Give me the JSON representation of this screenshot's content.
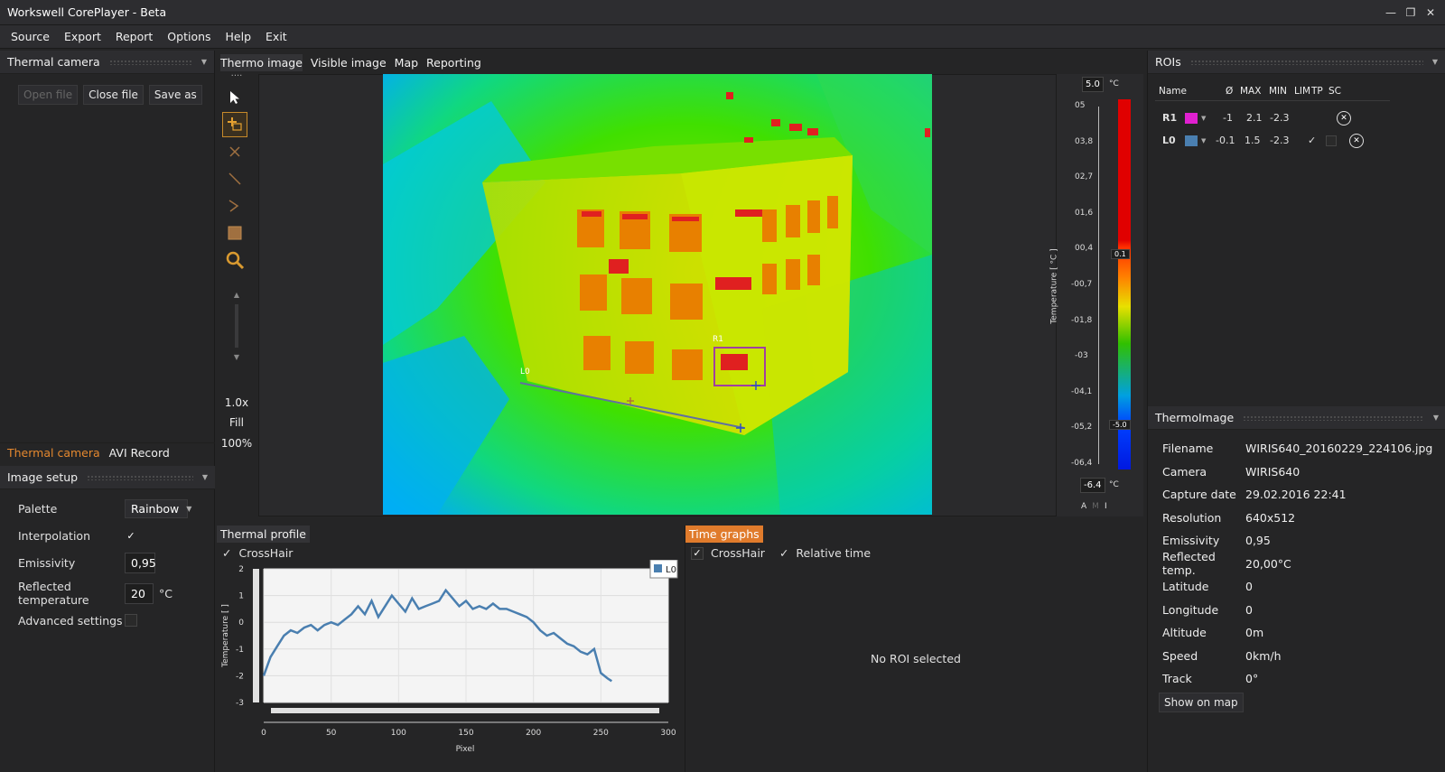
{
  "window": {
    "title": "Workswell CorePlayer - Beta"
  },
  "menu": [
    "Source",
    "Export",
    "Report",
    "Options",
    "Help",
    "Exit"
  ],
  "left": {
    "panel_title": "Thermal camera",
    "buttons": {
      "open": "Open file",
      "close": "Close file",
      "save": "Save as"
    },
    "tabs": [
      "Thermal camera",
      "AVI Record"
    ],
    "image_setup": {
      "title": "Image setup",
      "palette_label": "Palette",
      "palette_value": "Rainbow",
      "interpolation_label": "Interpolation",
      "emissivity_label": "Emissivity",
      "emissivity_value": "0,95",
      "reflected_label": "Reflected temperature",
      "reflected_value": "20",
      "reflected_unit": "°C",
      "advanced_label": "Advanced settings"
    }
  },
  "center": {
    "tabs": [
      "Thermo image",
      "Visible image",
      "Map",
      "Reporting"
    ],
    "zoom": "1.0x",
    "fill": "Fill",
    "percent": "100%",
    "roi_labels": {
      "r1": "R1",
      "l0": "L0"
    }
  },
  "scale": {
    "max": "5.0",
    "min": "-6.4",
    "unit": "°C",
    "upper_marker": "0.1",
    "lower_marker": "-5.0",
    "ticks": [
      "05",
      "03,8",
      "02,7",
      "01,6",
      "00,4",
      "-00,7",
      "-01,8",
      "-03",
      "-04,1",
      "-05,2",
      "-06,4"
    ],
    "axis_label": "Temperature [ °C ]",
    "modes": [
      "A",
      "M",
      "I"
    ]
  },
  "profile": {
    "tab": "Thermal profile",
    "crosshair": "CrossHair",
    "legend": "L0",
    "chart_data": {
      "type": "line",
      "xlabel": "Pixel",
      "ylabel": "Temperature [ ]",
      "xlim": [
        0,
        300
      ],
      "ylim": [
        -3,
        2
      ],
      "x_ticks": [
        "0",
        "50",
        "100",
        "150",
        "200",
        "250",
        "300"
      ],
      "y_ticks": [
        "2",
        "1",
        "0",
        "-1",
        "-2",
        "-3"
      ],
      "series": [
        {
          "name": "L0",
          "x": [
            0,
            5,
            10,
            15,
            20,
            25,
            30,
            35,
            40,
            45,
            50,
            55,
            60,
            65,
            70,
            75,
            80,
            85,
            90,
            95,
            100,
            105,
            110,
            115,
            120,
            125,
            130,
            135,
            140,
            145,
            150,
            155,
            160,
            165,
            170,
            175,
            180,
            185,
            190,
            195,
            200,
            205,
            210,
            215,
            220,
            225,
            230,
            235,
            240,
            245,
            250,
            255,
            258
          ],
          "values": [
            -2.0,
            -1.3,
            -0.9,
            -0.5,
            -0.3,
            -0.4,
            -0.2,
            -0.1,
            -0.3,
            -0.1,
            0.0,
            -0.1,
            0.1,
            0.3,
            0.6,
            0.3,
            0.8,
            0.2,
            0.6,
            1.0,
            0.7,
            0.4,
            0.9,
            0.5,
            0.6,
            0.7,
            0.8,
            1.2,
            0.9,
            0.6,
            0.8,
            0.5,
            0.6,
            0.5,
            0.7,
            0.5,
            0.5,
            0.4,
            0.3,
            0.2,
            0.0,
            -0.3,
            -0.5,
            -0.4,
            -0.6,
            -0.8,
            -0.9,
            -1.1,
            -1.2,
            -1.0,
            -1.9,
            -2.1,
            -2.2
          ]
        }
      ]
    }
  },
  "time_graphs": {
    "tab": "Time graphs",
    "crosshair": "CrossHair",
    "relative": "Relative time",
    "empty": "No ROI selected"
  },
  "rois": {
    "title": "ROIs",
    "columns": [
      "Name",
      "Ø",
      "MAX",
      "MIN",
      "LIM",
      "TP",
      "SC"
    ],
    "rows": [
      {
        "name": "R1",
        "color": "#e020d0",
        "avg": "-1",
        "max": "2.1",
        "min": "-2.3",
        "tp": "",
        "sc": ""
      },
      {
        "name": "L0",
        "color": "#4a7fb0",
        "avg": "-0.1",
        "max": "1.5",
        "min": "-2.3",
        "tp": "✓",
        "sc": ""
      }
    ]
  },
  "thermo_image": {
    "title": "ThermoImage",
    "fields": [
      {
        "k": "Filename",
        "v": "WIRIS640_20160229_224106.jpg"
      },
      {
        "k": "Camera",
        "v": "WIRIS640"
      },
      {
        "k": "Capture date",
        "v": "29.02.2016 22:41"
      },
      {
        "k": "Resolution",
        "v": "640x512"
      },
      {
        "k": "Emissivity",
        "v": "0,95"
      },
      {
        "k": "Reflected temp.",
        "v": "20,00°C"
      },
      {
        "k": "Latitude",
        "v": "0"
      },
      {
        "k": "Longitude",
        "v": "0"
      },
      {
        "k": "Altitude",
        "v": "0m"
      },
      {
        "k": "Speed",
        "v": "0km/h"
      },
      {
        "k": "Track",
        "v": "0°"
      }
    ],
    "show_map": "Show on map"
  },
  "colors": {
    "accent": "#e07b2c",
    "bg": "#252526",
    "line": "#4a7fb0"
  }
}
